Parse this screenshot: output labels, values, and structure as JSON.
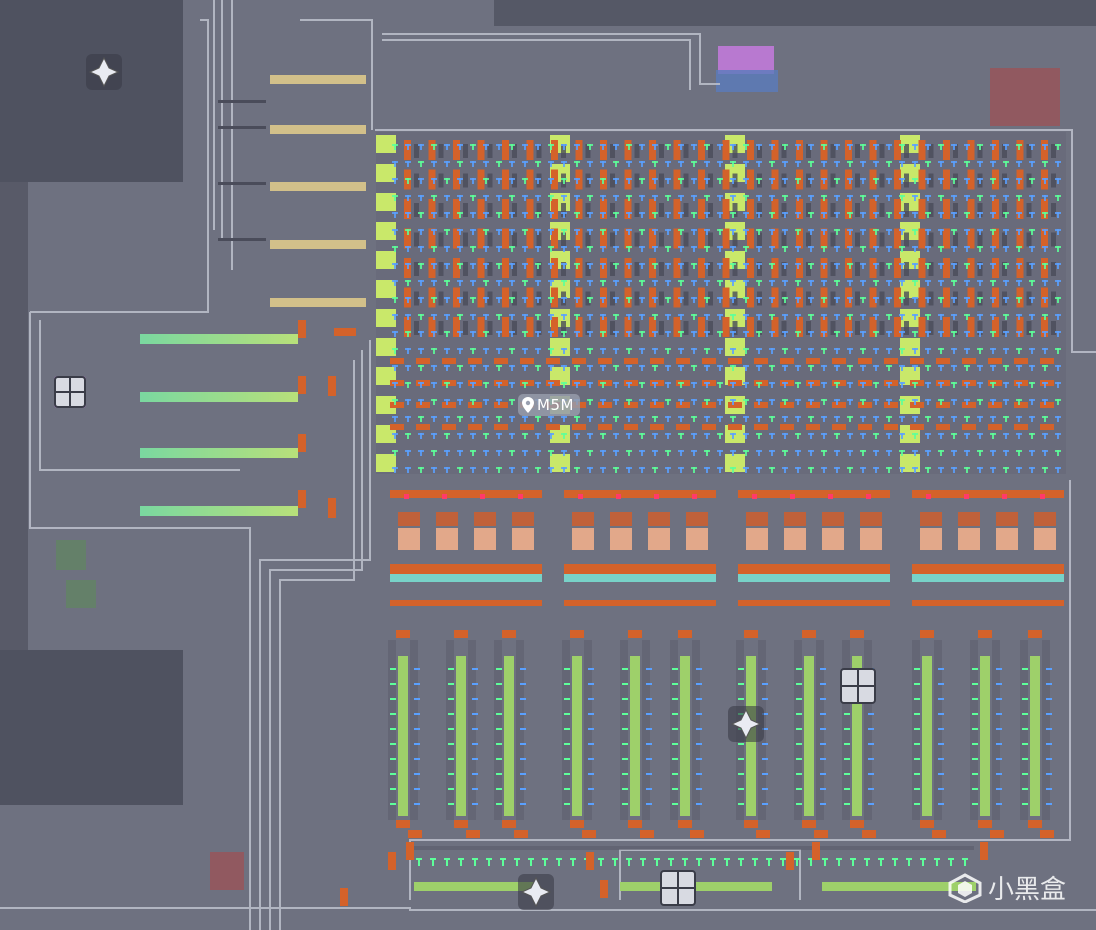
{
  "map_marker": {
    "label": "M5M",
    "icon": "map-pin-icon"
  },
  "watermark": {
    "text": "小黑盒",
    "icon": "heybox-logo-icon"
  },
  "palette": {
    "ground": "#6e7180",
    "dark_void": "#4a4c5a",
    "wire": "#b9bdc9",
    "lime_block": "#c9e86a",
    "orange_block": "#d4622a",
    "green_pipe": "#9ed06a",
    "teal_bar": "#78d2c8",
    "tan_bar": "#d2c08a",
    "blue_tick": "#5aa0ff",
    "green_tick": "#5dff9a",
    "pink_dot": "#ff3a6a",
    "peach": "#e2a88a"
  }
}
